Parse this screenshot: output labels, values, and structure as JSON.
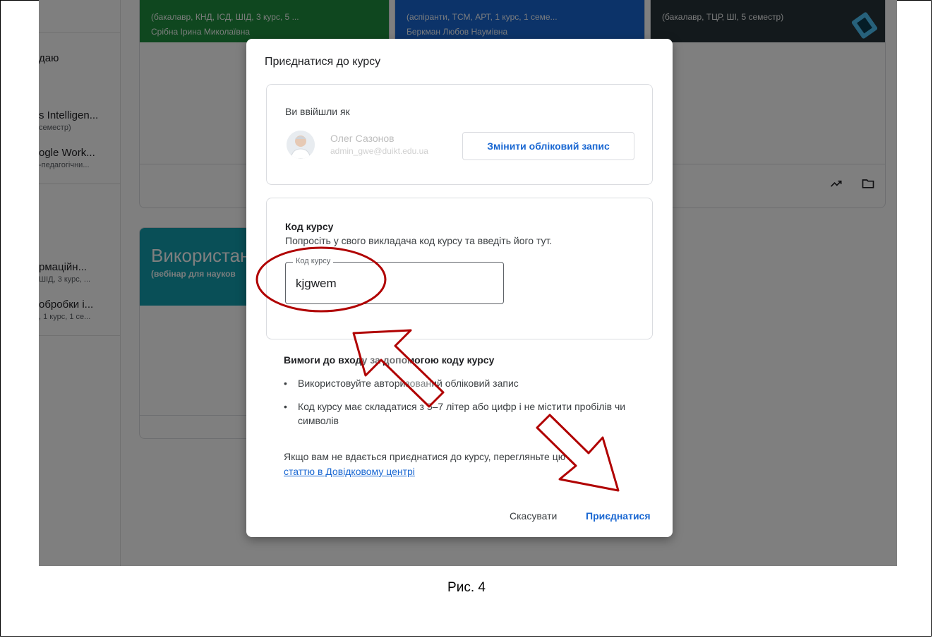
{
  "background": {
    "sidebar": {
      "items": [
        {
          "title": "даю",
          "subtitle": ""
        },
        {
          "title": "s Intelligen...",
          "subtitle": "семестр)"
        },
        {
          "title": "ogle Work...",
          "subtitle": "-педагогічни..."
        },
        {
          "title": "рмаційн...",
          "subtitle": "ШІД, 3 курс, ..."
        },
        {
          "title": "обробки і...",
          "subtitle": ", 1 курс, 1 се..."
        }
      ]
    },
    "cards": [
      {
        "subtitle": "(бакалавр, КНД, ІСД, ШІД, 3 курс, 5 ...",
        "teacher": "Срібна Ірина Миколаївна",
        "color": "#1e8e3e"
      },
      {
        "subtitle": "(аспіранти, ТСМ, АРТ, 1 курс, 1 семе...",
        "teacher": "Беркман Любов Наумівна",
        "color": "#1967d2"
      },
      {
        "subtitle": "(бакалавр, ТЦР, ШІ, 5 семестр)",
        "teacher": "",
        "color": "#263238"
      },
      {
        "title": "Використан",
        "subtitle": "(вебінар для науков",
        "color": "#129eaf"
      }
    ],
    "card_icons": [
      "trending-icon",
      "folder-icon"
    ]
  },
  "dialog": {
    "title": "Приєднатися до курсу",
    "account": {
      "label": "Ви ввійшли як",
      "name": "Олег Сазонов",
      "email": "admin_gwe@duikt.edu.ua",
      "switch_button": "Змінити обліковий запис"
    },
    "code": {
      "heading": "Код курсу",
      "instruction": "Попросіть у свого викладача код курсу та введіть його тут.",
      "field_label": "Код курсу",
      "field_value": "kjgwem"
    },
    "requirements": {
      "title": "Вимоги до входу за допомогою коду курсу",
      "items": [
        "Використовуйте авторизований обліковий запис",
        "Код курсу має складатися з 5–7 літер або цифр і не містити пробілів чи символів"
      ]
    },
    "help": {
      "text": "Якщо вам не вдається приєднатися до курсу, перегляньте цю",
      "link": "статтю в Довідковому центрі"
    },
    "buttons": {
      "cancel": "Скасувати",
      "join": "Приєднатися"
    }
  },
  "annotation_color": "#b00000",
  "caption": "Рис. 4"
}
